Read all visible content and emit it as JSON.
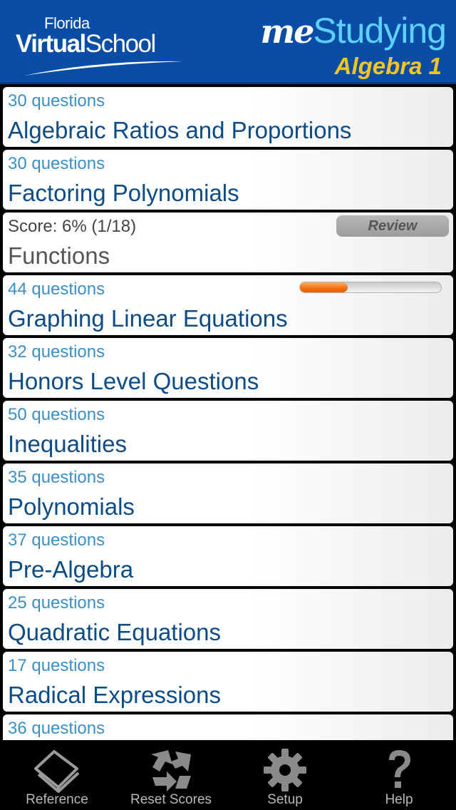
{
  "header": {
    "brand_small": "Florida",
    "brand_virtual": "Virtual",
    "brand_school": "School",
    "app_me": "me",
    "app_studying": "Studying",
    "subject": "Algebra 1"
  },
  "topics": [
    {
      "count": "30 questions",
      "title": "Algebraic Ratios and Proportions"
    },
    {
      "count": "30 questions",
      "title": "Factoring Polynomials"
    },
    {
      "count": "Score: 6% (1/18)",
      "title": "Functions",
      "review_label": "Review"
    },
    {
      "count": "44 questions",
      "title": "Graphing Linear Equations",
      "progress_fraction": 0.34
    },
    {
      "count": "32 questions",
      "title": "Honors Level Questions"
    },
    {
      "count": "50 questions",
      "title": "Inequalities"
    },
    {
      "count": "35 questions",
      "title": "Polynomials"
    },
    {
      "count": "37 questions",
      "title": "Pre-Algebra"
    },
    {
      "count": "25 questions",
      "title": "Quadratic Equations"
    },
    {
      "count": "17 questions",
      "title": "Radical Expressions"
    },
    {
      "count": "36 questions",
      "title": ""
    }
  ],
  "tabbar": {
    "items": [
      {
        "label": "Reference",
        "icon": "book-icon"
      },
      {
        "label": "Reset Scores",
        "icon": "recycle-icon"
      },
      {
        "label": "Setup",
        "icon": "gear-icon"
      },
      {
        "label": "Help",
        "icon": "question-icon"
      }
    ]
  },
  "colors": {
    "header_bg": "#0a4da6",
    "subject": "#f7c520",
    "studying": "#5fd0ff",
    "count_text": "#3b8fc7",
    "title_text": "#0d4b86",
    "progress": "#f26d0f"
  }
}
